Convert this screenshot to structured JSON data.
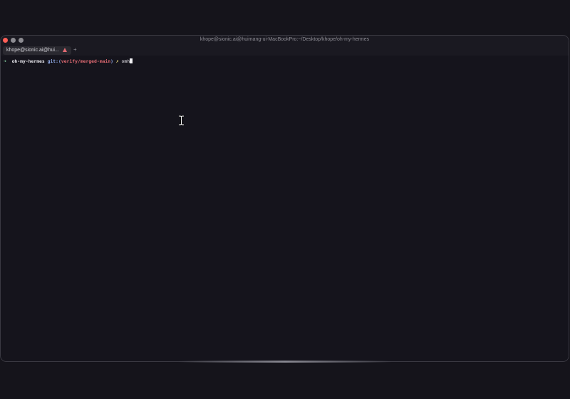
{
  "window": {
    "title": "khope@sionic.ai@huimang-ui-MacBookPro:~/Desktop/khope/oh-my-hermes"
  },
  "tabs": [
    {
      "label": "khope@sionic.ai@hui...",
      "status_icon": "warning-triangle-icon",
      "active": true
    }
  ],
  "tab_add_icon": "+",
  "terminal": {
    "prompt_arrow": "➜",
    "directory": "oh-my-hermes",
    "git_label": "git:",
    "paren_open": "(",
    "branch": "verify/merged-main",
    "paren_close": ")",
    "dirty_marker": "✗",
    "command": "omh"
  },
  "colors": {
    "background": "#15141c",
    "branch": "#e06a72",
    "git": "#8fa9e6",
    "arrow": "#8bd5a6",
    "dirty": "#e0d27a"
  }
}
